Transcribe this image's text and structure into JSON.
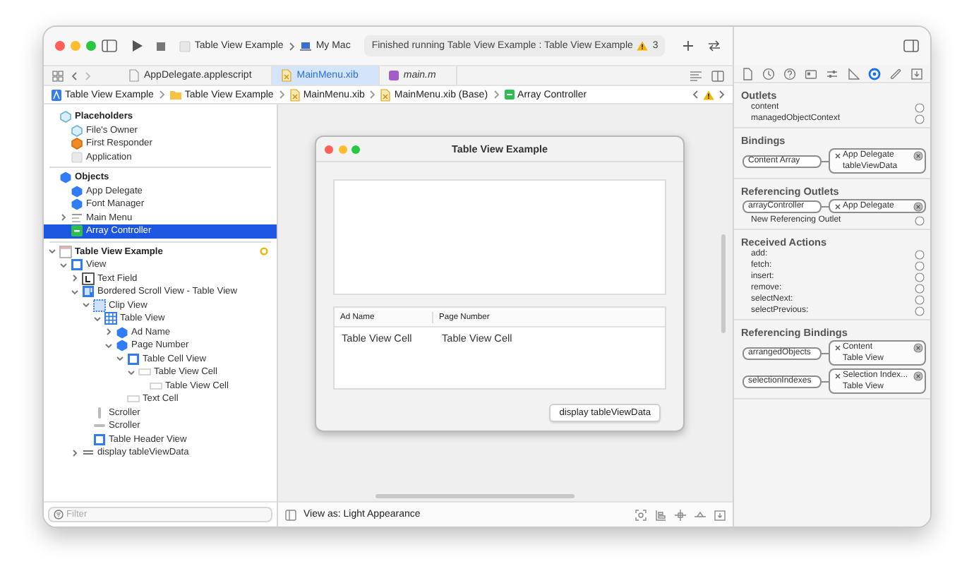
{
  "toolbar": {
    "scheme": "Table View Example",
    "destination": "My Mac",
    "status": "Finished running Table View Example : Table View Example",
    "warning_count": "3"
  },
  "tabs": [
    {
      "label": "AppDelegate.applescript",
      "kind": "applescript",
      "selected": false
    },
    {
      "label": "MainMenu.xib",
      "kind": "xib",
      "selected": true
    },
    {
      "label": "main.m",
      "kind": "m",
      "selected": false
    }
  ],
  "breadcrumb": [
    {
      "label": "Table View Example",
      "kind": "project"
    },
    {
      "label": "Table View Example",
      "kind": "folder"
    },
    {
      "label": "MainMenu.xib",
      "kind": "xib"
    },
    {
      "label": "MainMenu.xib (Base)",
      "kind": "xib"
    },
    {
      "label": "Array Controller",
      "kind": "controller"
    }
  ],
  "outline": {
    "items": [
      {
        "label": "Placeholders",
        "kind": "placeholder",
        "selected": false,
        "children": [
          {
            "label": "File's Owner",
            "kind": "placeholder",
            "selected": false
          },
          {
            "label": "First Responder",
            "kind": "responder",
            "selected": false
          },
          {
            "label": "Application",
            "kind": "app",
            "selected": false
          }
        ]
      },
      {
        "label": "Objects",
        "kind": "object",
        "selected": false,
        "children": [
          {
            "label": "App Delegate",
            "kind": "object",
            "selected": false
          },
          {
            "label": "Font Manager",
            "kind": "object",
            "selected": false
          },
          {
            "label": "Main Menu",
            "kind": "menu",
            "selected": false,
            "expanded": false
          },
          {
            "label": "Array Controller",
            "kind": "controller",
            "selected": true
          }
        ]
      },
      {
        "label": "Table View Example",
        "kind": "window",
        "selected": false,
        "expanded": true,
        "marker": true,
        "children": [
          {
            "label": "View",
            "kind": "view",
            "selected": false,
            "expanded": true,
            "children": [
              {
                "label": "Text Field",
                "kind": "textfield",
                "selected": false,
                "expanded": false
              },
              {
                "label": "Bordered Scroll View - Table View",
                "kind": "scrollview",
                "selected": false,
                "expanded": true,
                "children": [
                  {
                    "label": "Clip View",
                    "kind": "clipview",
                    "selected": false,
                    "expanded": true,
                    "children": [
                      {
                        "label": "Table View",
                        "kind": "tableview",
                        "selected": false,
                        "expanded": true,
                        "children": [
                          {
                            "label": "Ad Name",
                            "kind": "object",
                            "selected": false,
                            "expanded": false
                          },
                          {
                            "label": "Page Number",
                            "kind": "object",
                            "selected": false,
                            "expanded": true,
                            "children": [
                              {
                                "label": "Table Cell View",
                                "kind": "view",
                                "selected": false,
                                "expanded": true,
                                "children": [
                                  {
                                    "label": "Table View Cell",
                                    "kind": "cell",
                                    "selected": false,
                                    "expanded": true,
                                    "children": [
                                      {
                                        "label": "Table View Cell",
                                        "kind": "cell",
                                        "selected": false
                                      }
                                    ]
                                  }
                                ]
                              },
                              {
                                "label": "Text Cell",
                                "kind": "cell",
                                "selected": false
                              }
                            ]
                          }
                        ]
                      }
                    ]
                  },
                  {
                    "label": "Scroller",
                    "kind": "scroller-v",
                    "selected": false
                  },
                  {
                    "label": "Scroller",
                    "kind": "scroller-h",
                    "selected": false
                  },
                  {
                    "label": "Table Header View",
                    "kind": "view",
                    "selected": false
                  }
                ]
              },
              {
                "label": "display tableViewData",
                "kind": "button",
                "selected": false,
                "expanded": false
              }
            ]
          }
        ]
      }
    ],
    "filter": {
      "placeholder": "Filter"
    }
  },
  "canvas": {
    "window_title": "Table View Example",
    "table": {
      "columns": [
        "Ad Name",
        "Page Number"
      ],
      "rows": [
        [
          "Table View Cell",
          "Table View Cell"
        ]
      ]
    },
    "button": "display tableViewData",
    "appearance": "View as: Light Appearance"
  },
  "inspector": {
    "tabs": [
      {
        "kind": "file",
        "selected": false
      },
      {
        "kind": "history",
        "selected": false
      },
      {
        "kind": "help",
        "selected": false
      },
      {
        "kind": "identity",
        "selected": false
      },
      {
        "kind": "attributes",
        "selected": false
      },
      {
        "kind": "size",
        "selected": false
      },
      {
        "kind": "connections",
        "selected": true
      },
      {
        "kind": "bindings",
        "selected": false
      },
      {
        "kind": "effects",
        "selected": false
      }
    ],
    "sections": [
      {
        "title": "Outlets",
        "items": [
          {
            "kind": "outlet",
            "name": "content",
            "connected": false
          },
          {
            "kind": "outlet",
            "name": "managedObjectContext",
            "connected": false
          }
        ]
      },
      {
        "title": "Bindings",
        "items": [
          {
            "kind": "binding",
            "name": "Content Array",
            "target": "App Delegate",
            "detail": "tableViewData",
            "connected": true
          }
        ]
      },
      {
        "title": "Referencing Outlets",
        "items": [
          {
            "kind": "binding",
            "name": "arrayController",
            "target": "App Delegate",
            "connected": true
          },
          {
            "kind": "outlet",
            "name": "New Referencing Outlet",
            "connected": false
          }
        ]
      },
      {
        "title": "Received Actions",
        "items": [
          {
            "kind": "outlet",
            "name": "add:",
            "connected": false
          },
          {
            "kind": "outlet",
            "name": "fetch:",
            "connected": false
          },
          {
            "kind": "outlet",
            "name": "insert:",
            "connected": false
          },
          {
            "kind": "outlet",
            "name": "remove:",
            "connected": false
          },
          {
            "kind": "outlet",
            "name": "selectNext:",
            "connected": false
          },
          {
            "kind": "outlet",
            "name": "selectPrevious:",
            "connected": false
          }
        ]
      },
      {
        "title": "Referencing Bindings",
        "items": [
          {
            "kind": "binding",
            "name": "arrangedObjects",
            "target": "Content",
            "detail": "Table View",
            "connected": true
          },
          {
            "kind": "binding",
            "name": "selectionIndexes",
            "target": "Selection Index...",
            "detail": "Table View",
            "connected": true
          }
        ]
      }
    ]
  }
}
